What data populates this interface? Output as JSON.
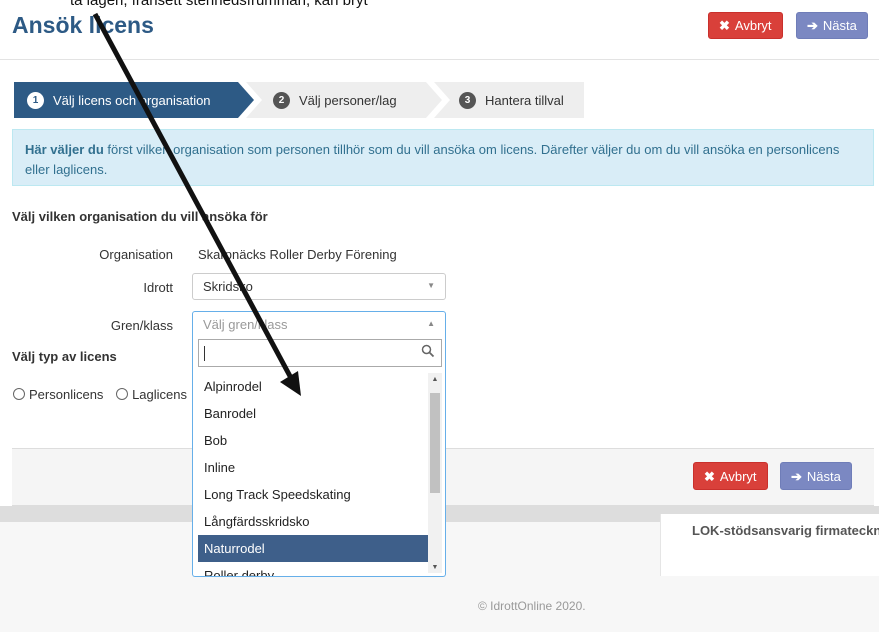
{
  "top_clip_text": "ta lagen, frånsett stenhedsfrumman, kan bryt",
  "page_title": "Ansök licens",
  "header": {
    "cancel_label": "Avbryt",
    "next_label": "Nästa"
  },
  "steps": [
    {
      "num": "1",
      "label": "Välj licens och organisation"
    },
    {
      "num": "2",
      "label": "Välj personer/lag"
    },
    {
      "num": "3",
      "label": "Hantera tillval"
    }
  ],
  "info": {
    "bold": "Här väljer du",
    "text": " först vilken organisation som personen tillhör som du vill ansöka om licens. Därefter väljer du om du vill ansöka en personlicens eller laglicens."
  },
  "org_section": {
    "title": "Välj vilken organisation du vill ansöka för",
    "organisation_label": "Organisation",
    "organisation_value": "Skarpnäcks Roller Derby Förening",
    "idrott_label": "Idrott",
    "idrott_value": "Skridsko",
    "gren_label": "Gren/klass",
    "gren_placeholder": "Välj gren/klass"
  },
  "license_type": {
    "title": "Välj typ av licens",
    "options": [
      "Personlicens",
      "Laglicens"
    ]
  },
  "dropdown": {
    "options": [
      "Alpinrodel",
      "Banrodel",
      "Bob",
      "Inline",
      "Long Track Speedskating",
      "Långfärdsskridsko",
      "Naturrodel",
      "Roller derby"
    ],
    "highlighted": "Naturrodel"
  },
  "footer": {
    "cancel_label": "Avbryt",
    "next_label": "Nästa"
  },
  "lok_title": "LOK-stödsansvarig firmatecknare",
  "copyright": "© IdrottOnline 2020.",
  "colors": {
    "primary": "#2d5a85",
    "danger": "#d9403a",
    "next": "#7b88c2",
    "info_bg": "#d9edf7",
    "highlight": "#3e5f8a"
  }
}
